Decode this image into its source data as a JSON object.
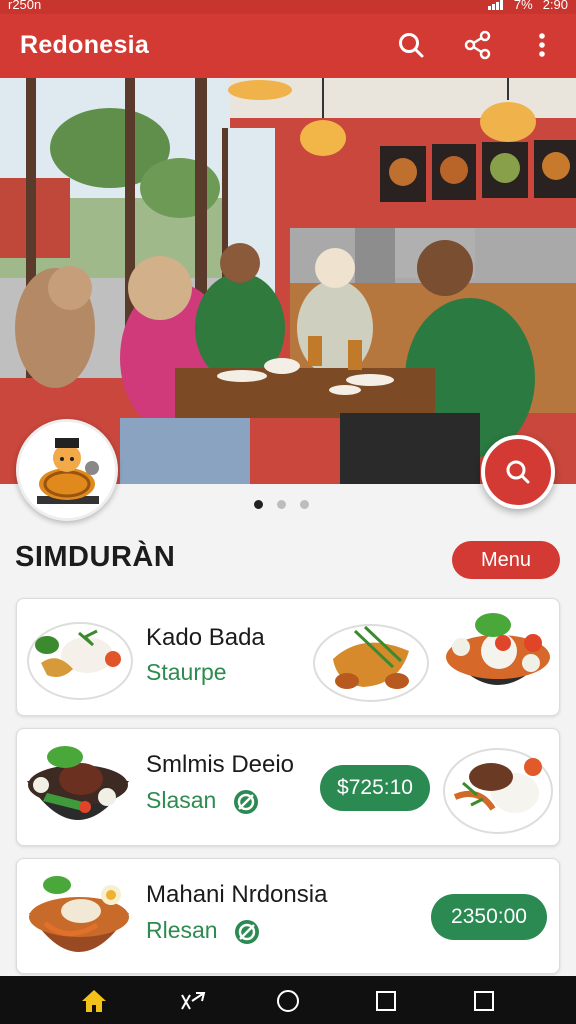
{
  "status": {
    "time": "r250n",
    "battery": "7%",
    "clock_right": "2:90"
  },
  "app": {
    "title": "Redonesia"
  },
  "icons": {
    "search": "search-icon",
    "share": "share-icon",
    "more": "more-vert-icon",
    "home": "home-icon",
    "back": "back-icon",
    "circle": "home-circle-icon",
    "square": "recents-icon"
  },
  "carousel": {
    "pages": 3,
    "active": 0
  },
  "section": {
    "title": "SIMDURÀN",
    "menu_label": "Menu"
  },
  "items": [
    {
      "name": "Kado Bada",
      "subtitle": "Staurpe",
      "price": ""
    },
    {
      "name": "Smlmis Deeio",
      "subtitle": "Slasan",
      "price": "$725:10"
    },
    {
      "name": "Mahani Nrdonsia",
      "subtitle": "Rlesan",
      "price": "2350:00"
    }
  ],
  "colors": {
    "brand_red": "#d23a33",
    "accent_green": "#2a8a52"
  }
}
